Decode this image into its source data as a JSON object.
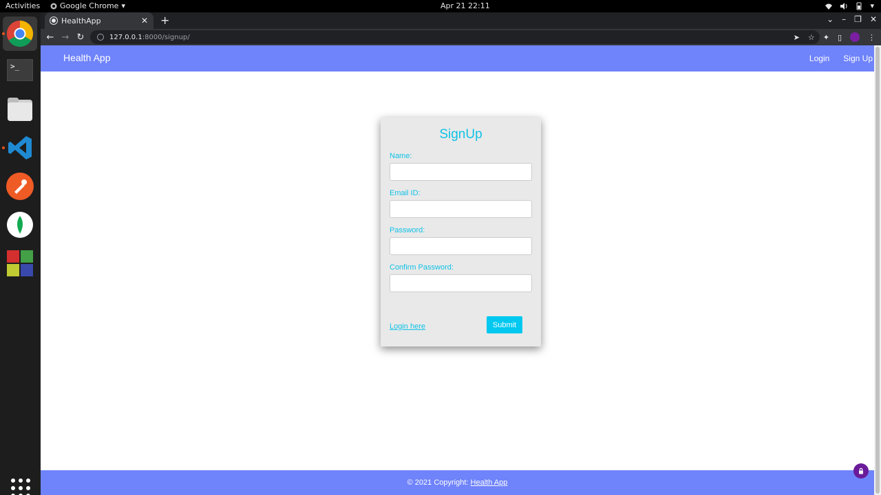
{
  "system": {
    "activities": "Activities",
    "app_menu": "Google Chrome",
    "clock": "Apr 21  22:11"
  },
  "dock": {
    "apps": [
      "chrome-icon",
      "terminal-icon",
      "files-icon",
      "vscode-icon",
      "postman-icon",
      "mongodb-compass-icon",
      "app-icon"
    ],
    "show_apps": "show-apps-icon"
  },
  "browser": {
    "tab_title": "HealthApp",
    "url_host": "127.0.0.1",
    "url_path": ":8000/signup/"
  },
  "page": {
    "brand": "Health App",
    "nav": {
      "login": "Login",
      "signup": "Sign Up"
    },
    "form": {
      "title": "SignUp",
      "fields": [
        {
          "label": "Name:",
          "value": ""
        },
        {
          "label": "Email ID:",
          "value": ""
        },
        {
          "label": "Password:",
          "value": ""
        },
        {
          "label": "Confirm Password:",
          "value": ""
        }
      ],
      "login_link": "Login here",
      "submit": "Submit"
    },
    "footer": {
      "prefix": "© 2021 Copyright: ",
      "link": "Health App"
    }
  },
  "colors": {
    "navbar": "#6f83fb",
    "accent": "#10c2e6",
    "card_bg": "#e9e9e9"
  }
}
